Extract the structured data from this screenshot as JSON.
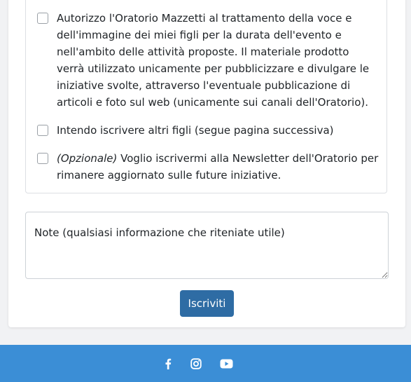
{
  "consents": [
    {
      "text": "Autorizzo l'Oratorio Mazzetti al trattamento della voce e dell'immagine dei miei figli per la durata dell'evento e nell'ambito delle attività proposte. Il materiale prodotto verrà utilizzato unicamente per pubblicizzare e divulgare le iniziative svolte, attraverso l'eventuale pubblicazione di articoli e foto sul web (unicamente sui canali dell'Oratorio).",
      "checked": false
    },
    {
      "text": "Intendo iscrivere altri figli (segue pagina successiva)",
      "checked": false
    },
    {
      "prefix": "(Opzionale)",
      "text": " Voglio iscrivermi alla Newsletter dell'Oratorio per rimanere aggiornato sulle future iniziative.",
      "checked": false
    }
  ],
  "notes": {
    "placeholder": "Note (qualsiasi informazione che riteniate utile)",
    "value": ""
  },
  "submit_label": "Iscriviti",
  "footer": {
    "background": "#3b8ed6",
    "social_icons": [
      "facebook-icon",
      "instagram-icon",
      "youtube-icon"
    ]
  },
  "colors": {
    "button": "#2e6ca4",
    "page_background": "#f1f2f4"
  }
}
